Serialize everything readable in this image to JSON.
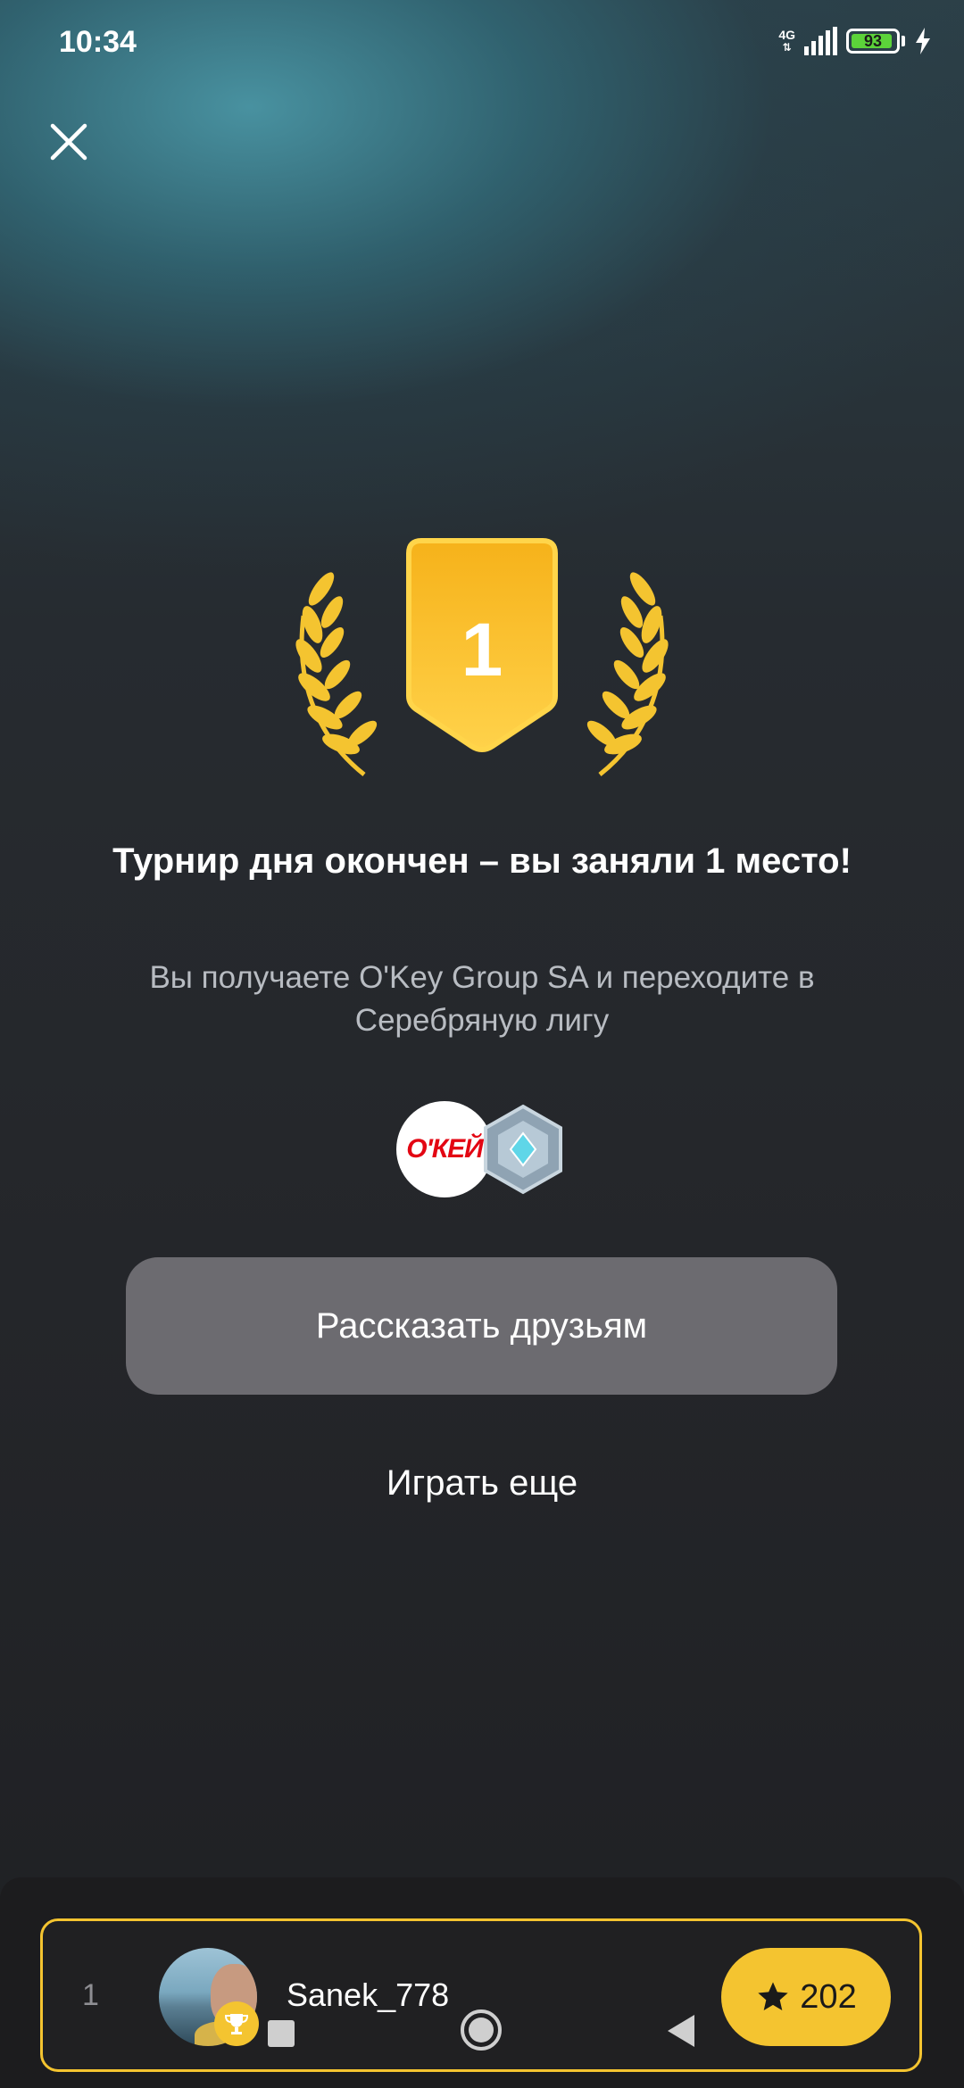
{
  "status_bar": {
    "time": "10:34",
    "network": "4G",
    "battery": "93",
    "battery_level_percent": 93
  },
  "icons": {
    "close": "close-icon",
    "star": "star-icon",
    "trophy": "trophy-icon",
    "laurel": "laurel-icon"
  },
  "badge": {
    "place": "1"
  },
  "result": {
    "title": "Турнир дня окончен – вы заняли 1 место!",
    "subtitle": "Вы получаете O'Key Group SA и переходите в Серебряную лигу"
  },
  "rewards": {
    "company_logo_text": "О'КЕЙ",
    "league": "silver-league-gem"
  },
  "actions": {
    "share_label": "Рассказать друзьям",
    "play_again_label": "Играть еще"
  },
  "leaderboard_row": {
    "rank": "1",
    "username": "Sanek_778",
    "score": "202"
  },
  "colors": {
    "accent": "#f4c430",
    "button_bg": "#6c6b70",
    "battery": "#5cd33a"
  }
}
